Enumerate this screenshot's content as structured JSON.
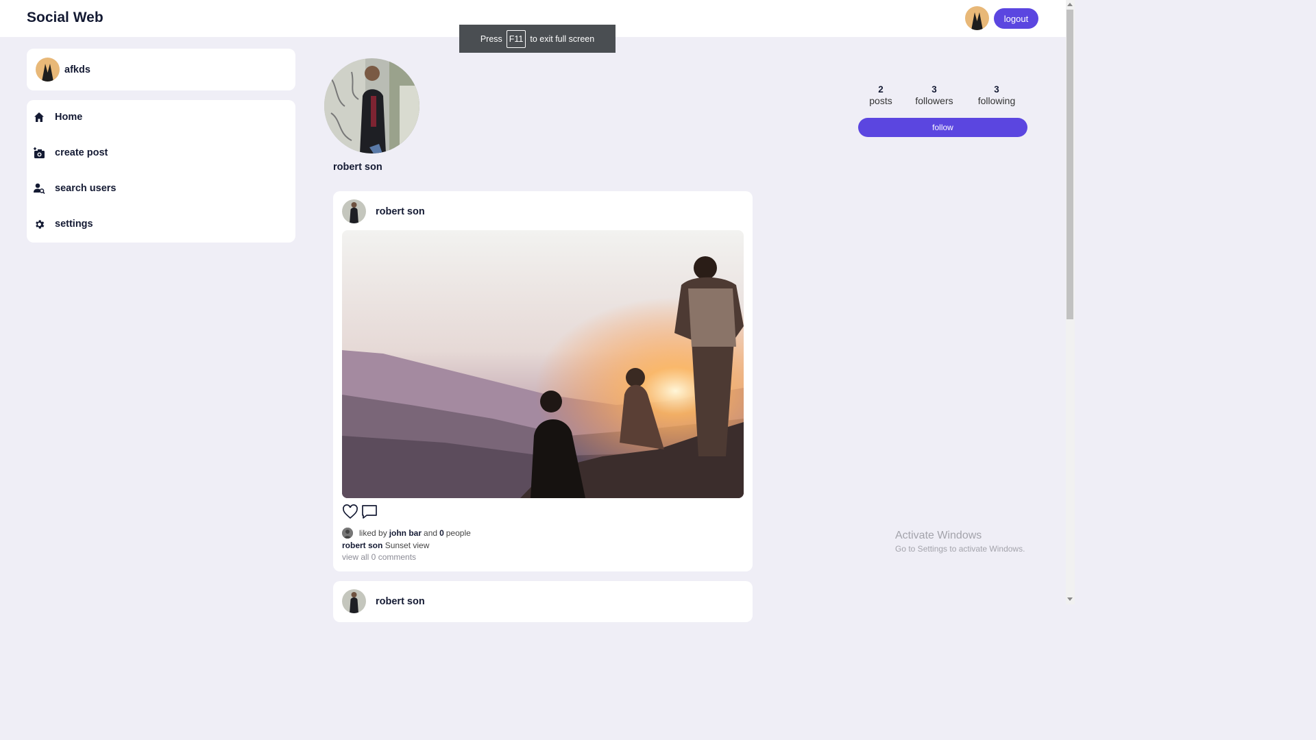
{
  "app": {
    "brand": "Social Web"
  },
  "header": {
    "logout_label": "logout",
    "avatar_icon": "user-avatar-icon"
  },
  "fullscreen_toast": {
    "prefix": "Press",
    "key": "F11",
    "suffix": "to exit full screen"
  },
  "current_user": {
    "username": "afkds"
  },
  "nav": {
    "items": [
      {
        "label": "Home",
        "icon": "home-icon"
      },
      {
        "label": "create post",
        "icon": "camera-plus-icon"
      },
      {
        "label": "search users",
        "icon": "user-search-icon"
      },
      {
        "label": "settings",
        "icon": "gear-icon"
      }
    ]
  },
  "profile": {
    "name": "robert son",
    "stats": [
      {
        "value": "2",
        "label": "posts"
      },
      {
        "value": "3",
        "label": "followers"
      },
      {
        "value": "3",
        "label": "following"
      }
    ],
    "follow_label": "follow"
  },
  "posts": [
    {
      "author": "robert son",
      "liked_by_prefix": "liked by",
      "liked_by_user": "john bar",
      "liked_and": "and",
      "liked_count": "0",
      "liked_suffix": "people",
      "caption_author": "robert son",
      "caption_text": "Sunset view",
      "comments_link": "view all 0 comments"
    },
    {
      "author": "robert son"
    }
  ],
  "watermark": {
    "title": "Activate Windows",
    "subtitle": "Go to Settings to activate Windows."
  },
  "colors": {
    "accent": "#5b46e0",
    "background": "#efeef6",
    "text_dark": "#141a33"
  }
}
